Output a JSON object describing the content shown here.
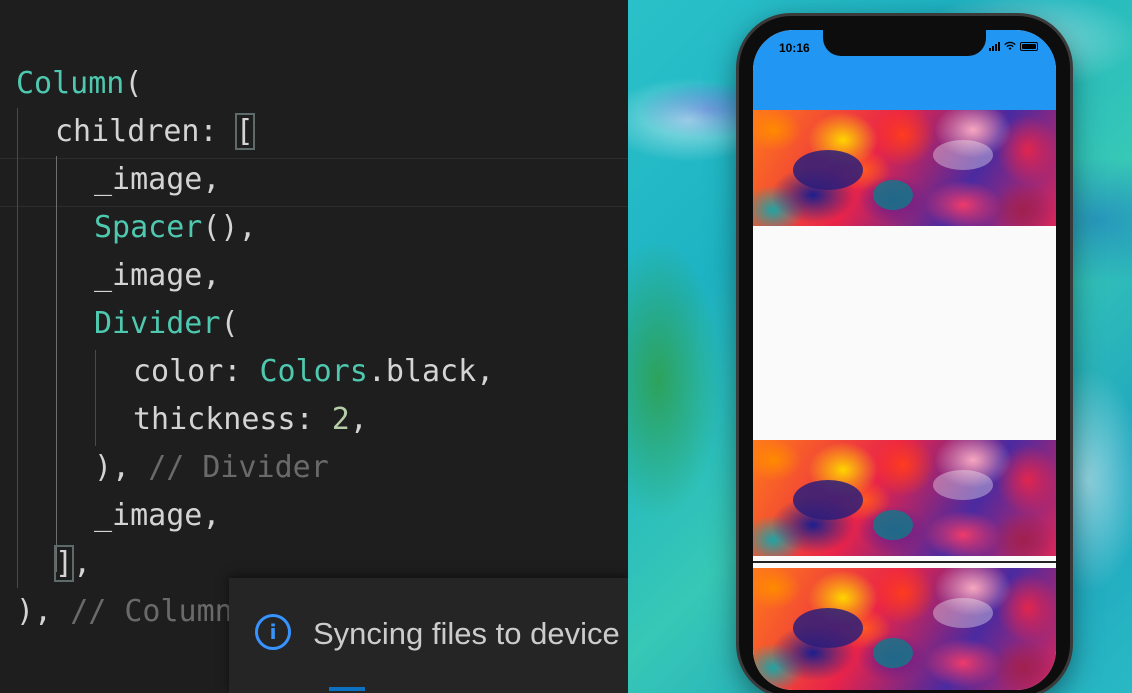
{
  "editor": {
    "lines": [
      {
        "indent": 0,
        "tokens": [
          {
            "t": "Column",
            "c": "class"
          },
          {
            "t": "(",
            "c": "punc"
          }
        ]
      },
      {
        "indent": 2,
        "tokens": [
          {
            "t": "children",
            "c": "prop"
          },
          {
            "t": ": ",
            "c": "punc"
          },
          {
            "t": "[",
            "c": "punc",
            "box": true
          }
        ]
      },
      {
        "indent": 4,
        "tokens": [
          {
            "t": "_image",
            "c": "prop"
          },
          {
            "t": ",",
            "c": "punc"
          }
        ]
      },
      {
        "indent": 4,
        "tokens": [
          {
            "t": "Spacer",
            "c": "class"
          },
          {
            "t": "(),",
            "c": "punc"
          }
        ]
      },
      {
        "indent": 4,
        "tokens": [
          {
            "t": "_image",
            "c": "prop"
          },
          {
            "t": ",",
            "c": "punc"
          }
        ]
      },
      {
        "indent": 4,
        "tokens": [
          {
            "t": "Divider",
            "c": "class"
          },
          {
            "t": "(",
            "c": "punc"
          }
        ]
      },
      {
        "indent": 6,
        "tokens": [
          {
            "t": "color",
            "c": "prop"
          },
          {
            "t": ": ",
            "c": "punc"
          },
          {
            "t": "Colors",
            "c": "class"
          },
          {
            "t": ".black,",
            "c": "punc"
          }
        ]
      },
      {
        "indent": 6,
        "tokens": [
          {
            "t": "thickness",
            "c": "prop"
          },
          {
            "t": ": ",
            "c": "punc"
          },
          {
            "t": "2",
            "c": "num"
          },
          {
            "t": ",",
            "c": "punc"
          }
        ]
      },
      {
        "indent": 4,
        "tokens": [
          {
            "t": "), ",
            "c": "punc"
          },
          {
            "t": "// Divider",
            "c": "cmt"
          }
        ]
      },
      {
        "indent": 4,
        "tokens": [
          {
            "t": "_image",
            "c": "prop"
          },
          {
            "t": ",",
            "c": "punc"
          }
        ]
      },
      {
        "indent": 2,
        "tokens": [
          {
            "t": "]",
            "c": "punc",
            "box": true
          },
          {
            "t": ",",
            "c": "punc"
          }
        ]
      },
      {
        "indent": 0,
        "tokens": [
          {
            "t": "), ",
            "c": "punc"
          },
          {
            "t": "// Column",
            "c": "cmt"
          }
        ]
      }
    ],
    "colors": {
      "class": "#4ec9b0",
      "num": "#b5cea8",
      "comment": "#6a6a6a",
      "text": "#d4d4d4",
      "background": "#1e1e1e"
    }
  },
  "notification": {
    "icon": "info-icon",
    "icon_glyph": "i",
    "message": "Syncing files to device"
  },
  "simulator": {
    "status_bar": {
      "time": "10:16",
      "icons": [
        "signal-icon",
        "wifi-icon",
        "battery-icon"
      ]
    },
    "app_bar_color": "#2196f3",
    "body": [
      {
        "type": "image",
        "name": "image-1"
      },
      {
        "type": "spacer",
        "name": "spacer"
      },
      {
        "type": "image",
        "name": "image-2"
      },
      {
        "type": "divider",
        "name": "divider",
        "color": "#000000",
        "thickness": 2
      },
      {
        "type": "image",
        "name": "image-3"
      }
    ]
  }
}
